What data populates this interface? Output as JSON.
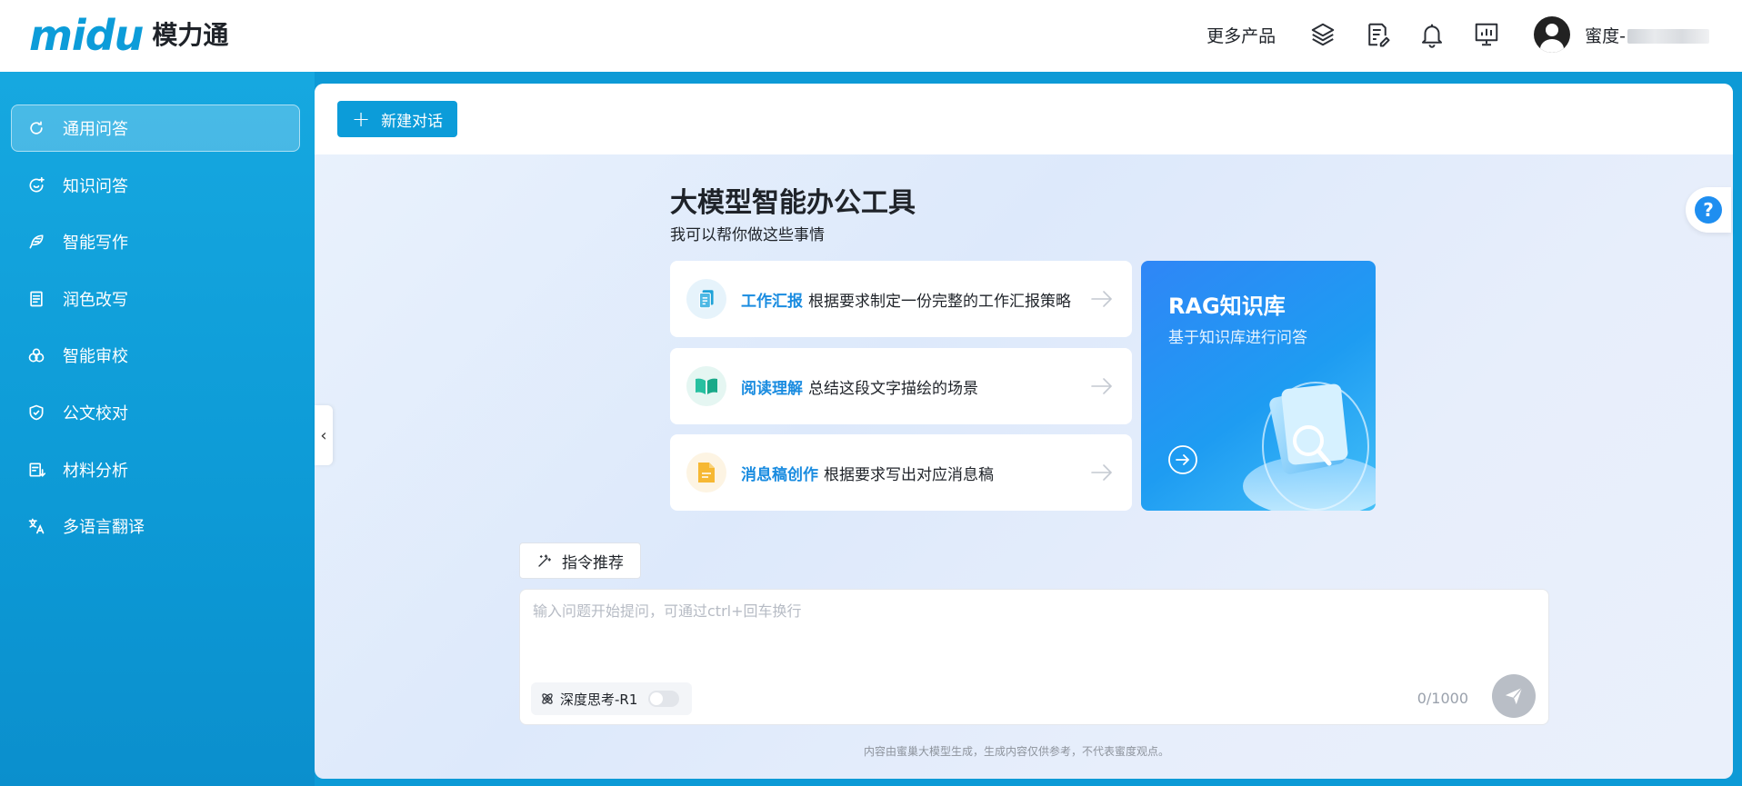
{
  "header": {
    "logo_mark": "midu",
    "logo_text": "模力通",
    "more_products": "更多产品",
    "user_name": "蜜度-"
  },
  "sidebar": {
    "items": [
      {
        "label": "通用问答",
        "icon": "chat-icon",
        "active": true
      },
      {
        "label": "知识问答",
        "icon": "knowledge-chat-icon",
        "active": false
      },
      {
        "label": "智能写作",
        "icon": "pen-icon",
        "active": false
      },
      {
        "label": "润色改写",
        "icon": "document-icon",
        "active": false
      },
      {
        "label": "智能审校",
        "icon": "review-icon",
        "active": false
      },
      {
        "label": "公文校对",
        "icon": "shield-check-icon",
        "active": false
      },
      {
        "label": "材料分析",
        "icon": "analysis-icon",
        "active": false
      },
      {
        "label": "多语言翻译",
        "icon": "translate-icon",
        "active": false
      }
    ]
  },
  "main": {
    "new_chat_label": "新建对话",
    "title": "大模型智能办公工具",
    "subtitle": "我可以帮你做这些事情",
    "cards": [
      {
        "title": "工作汇报",
        "desc": "根据要求制定一份完整的工作汇报策略",
        "icon": "report-icon"
      },
      {
        "title": "阅读理解",
        "desc": "总结这段文字描绘的场景",
        "icon": "book-icon"
      },
      {
        "title": "消息稿创作",
        "desc": "根据要求写出对应消息稿",
        "icon": "file-icon"
      }
    ],
    "rag": {
      "title": "RAG知识库",
      "subtitle": "基于知识库进行问答"
    },
    "command_label": "指令推荐",
    "input_placeholder": "输入问题开始提问，可通过ctrl+回车换行",
    "deep_think_label": "深度思考-R1",
    "deep_think_on": false,
    "counter": "0/1000",
    "footnote": "内容由蜜巢大模型生成，生成内容仅供参考，不代表蜜度观点。"
  },
  "colors": {
    "brand": "#0c9cd9",
    "accent_text": "#1a8ce0"
  }
}
